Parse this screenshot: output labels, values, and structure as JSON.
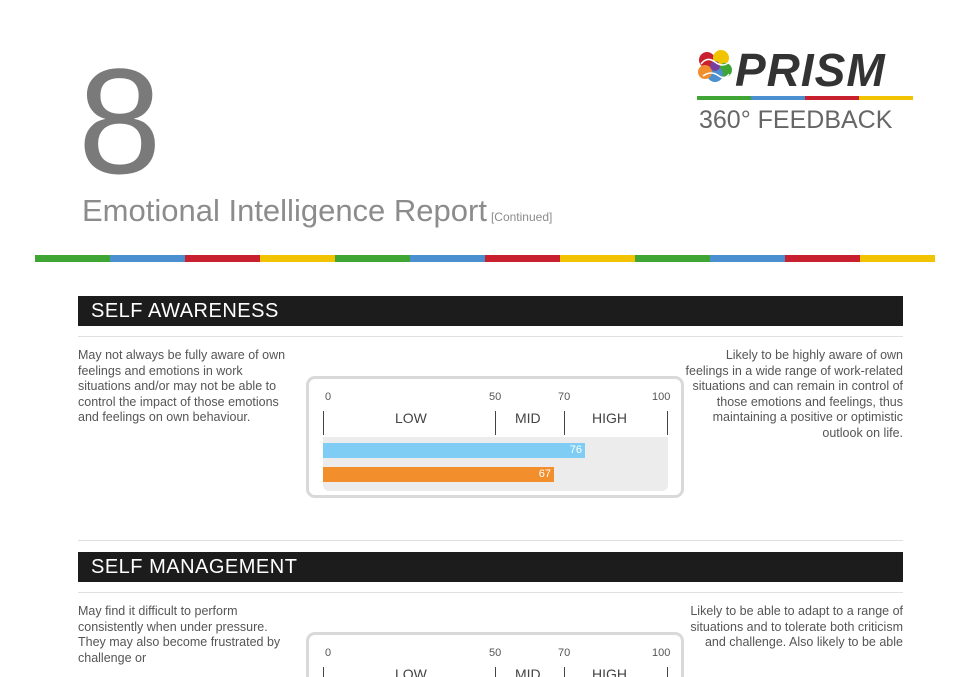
{
  "page": {
    "number": "8",
    "title": "Emotional Intelligence Report",
    "title_suffix": "[Continued]"
  },
  "logo": {
    "word": "PRISM",
    "subtitle": "360° FEEDBACK",
    "brain_icon": "brain-icon"
  },
  "colors": {
    "green": "#3fa535",
    "blue": "#4a8fcf",
    "red": "#c8202f",
    "yellow": "#f2c300",
    "bar_self": "#7fcdf5",
    "bar_others": "#f28f2c",
    "header_bg": "#1c1c1c"
  },
  "scale": {
    "tick_values": [
      "0",
      "50",
      "70",
      "100"
    ],
    "bands": [
      "LOW",
      "MID",
      "HIGH"
    ]
  },
  "sections": [
    {
      "heading": "SELF AWARENESS",
      "left_text": "May not always be fully aware of own feelings and emotions in work situations and/or may not be able to control the impact of those emotions and feelings on own behaviour.",
      "right_text": "Likely to be highly aware of own feelings in a wide range of work-related situations and can remain in control of those emotions and feelings, thus maintaining a positive or optimistic outlook on life.",
      "scores": [
        {
          "value": 76,
          "label": "76"
        },
        {
          "value": 67,
          "label": "67"
        }
      ]
    },
    {
      "heading": "SELF MANAGEMENT",
      "left_text": "May find it difficult to perform consistently when under pressure. They may also become frustrated by challenge or",
      "right_text": "Likely to be able to adapt to a range of situations and to tolerate both criticism and challenge. Also likely to be able",
      "scores": []
    }
  ]
}
